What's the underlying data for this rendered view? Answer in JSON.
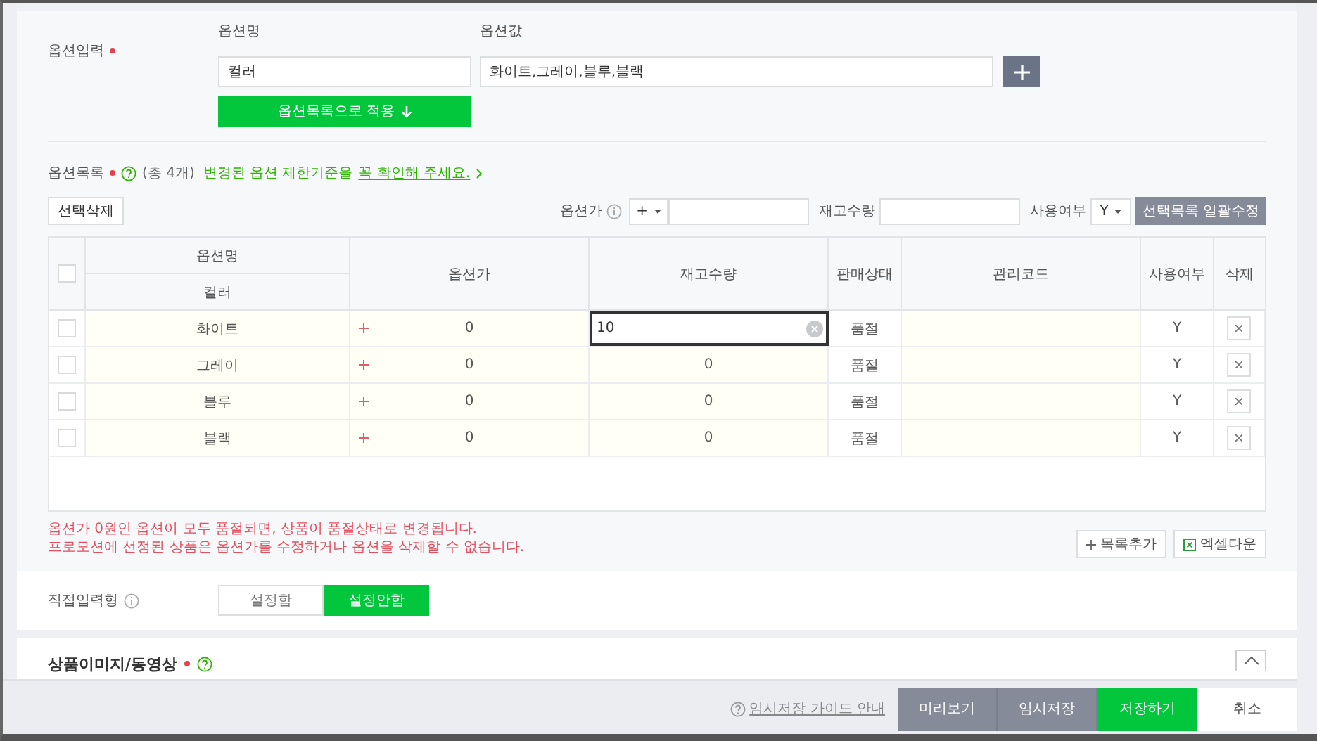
{
  "option_input": {
    "label": "옵션입력",
    "required": true,
    "name_label": "옵션명",
    "value_label": "옵션값",
    "name_value": "컬러",
    "values_value": "화이트,그레이,블루,블랙",
    "apply_button": "옵션목록으로 적용"
  },
  "option_list": {
    "label": "옵션목록",
    "required": true,
    "count": "(총 4개)",
    "notice": "변경된 옵션 제한기준을",
    "notice_link": "꼭 확인해 주세요."
  },
  "toolbar": {
    "delete_button": "선택삭제",
    "price_label": "옵션가",
    "price_sign": "+",
    "stock_label": "재고수량",
    "use_label": "사용여부",
    "use_value": "Y",
    "bulk_button": "선택목록 일괄수정"
  },
  "table": {
    "group_header": "옵션명",
    "sub_header": "컬러",
    "columns": [
      "옵션가",
      "재고수량",
      "판매상태",
      "관리코드",
      "사용여부",
      "삭제"
    ],
    "all_checked": false,
    "rows": [
      {
        "checked": false,
        "name": "화이트",
        "price": "0",
        "stock": "10",
        "editing": true,
        "status": "품절",
        "use": "Y"
      },
      {
        "checked": false,
        "name": "그레이",
        "price": "0",
        "stock": "0",
        "editing": false,
        "status": "품절",
        "use": "Y"
      },
      {
        "checked": false,
        "name": "블루",
        "price": "0",
        "stock": "0",
        "editing": false,
        "status": "품절",
        "use": "Y"
      },
      {
        "checked": false,
        "name": "블랙",
        "price": "0",
        "stock": "0",
        "editing": false,
        "status": "품절",
        "use": "Y"
      }
    ]
  },
  "notes": [
    "옵션가 0원인 옵션이 모두 품절되면, 상품이 품절상태로 변경됩니다.",
    "프로모션에 선정된 상품은 옵션가를 수정하거나 옵션을 삭제할 수 없습니다."
  ],
  "list_buttons": [
    {
      "label": "목록추가",
      "kind": "add"
    },
    {
      "label": "엑셀다운",
      "kind": "excel"
    }
  ],
  "direct_input": {
    "label": "직접입력형",
    "options": [
      {
        "label": "설정함",
        "selected": false
      },
      {
        "label": "설정안함",
        "selected": true
      }
    ]
  },
  "image_section": {
    "title": "상품이미지/동영상",
    "required": true
  },
  "footer": {
    "guide_link": "임시저장 가이드 안내",
    "buttons": [
      {
        "label": "미리보기",
        "kind": "secondary"
      },
      {
        "label": "임시저장",
        "kind": "secondary"
      },
      {
        "label": "저장하기",
        "kind": "primary"
      },
      {
        "label": "취소",
        "kind": "plain"
      }
    ]
  }
}
